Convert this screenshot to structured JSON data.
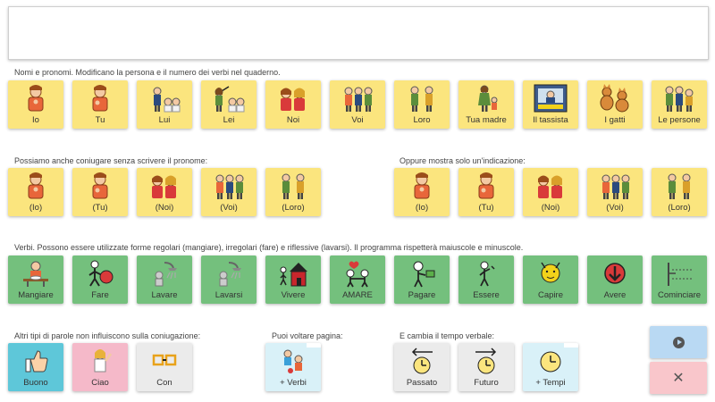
{
  "message_bar": {
    "text": ""
  },
  "sections": {
    "nomi": "Nomi e pronomi. Modificano la persona e il numero dei verbi nel quaderno.",
    "possiamo": "Possiamo anche coniugare senza scrivere il pronome:",
    "oppure": "Oppure mostra solo un'indicazione:",
    "verbi": "Verbi. Possono essere utilizzate forme regolari (mangiare), irregolari (fare) e riflessive (lavarsi). Il programma rispetterà maiuscole e minuscole.",
    "altri": "Altri tipi di parole non influiscono sulla coniugazione:",
    "puoi": "Puoi voltare pagina:",
    "cambia": "E cambia il tempo verbale:"
  },
  "rows": {
    "pronomi": [
      "Io",
      "Tu",
      "Lui",
      "Lei",
      "Noi",
      "Voi",
      "Loro",
      "Tua madre",
      "Il tassista",
      "I gatti",
      "Le persone"
    ],
    "senza_pronome": [
      "(Io)",
      "(Tu)",
      "(Noi)",
      "(Voi)",
      "(Loro)"
    ],
    "indicazione": [
      "(Io)",
      "(Tu)",
      "(Noi)",
      "(Voi)",
      "(Loro)"
    ],
    "verbi": [
      "Mangiare",
      "Fare",
      "Lavare",
      "Lavarsi",
      "Vivere",
      "AMARE",
      "Pagare",
      "Essere",
      "Capire",
      "Avere",
      "Cominciare"
    ],
    "altri": [
      "Buono",
      "Ciao",
      "Con"
    ],
    "pagina": [
      "+ Verbi"
    ],
    "tempi": [
      "Passato",
      "Futuro",
      "+ Tempi"
    ]
  },
  "controls": {
    "play_icon": "play-icon",
    "close_icon": "close-icon",
    "close_glyph": "✕"
  },
  "colors": {
    "pronoun": "#fbe57e",
    "verb": "#74c07d",
    "adjective": "#5ec7d9",
    "social": "#f5b9c9",
    "misc": "#ebebeb",
    "folder": "#d9f1f8"
  }
}
